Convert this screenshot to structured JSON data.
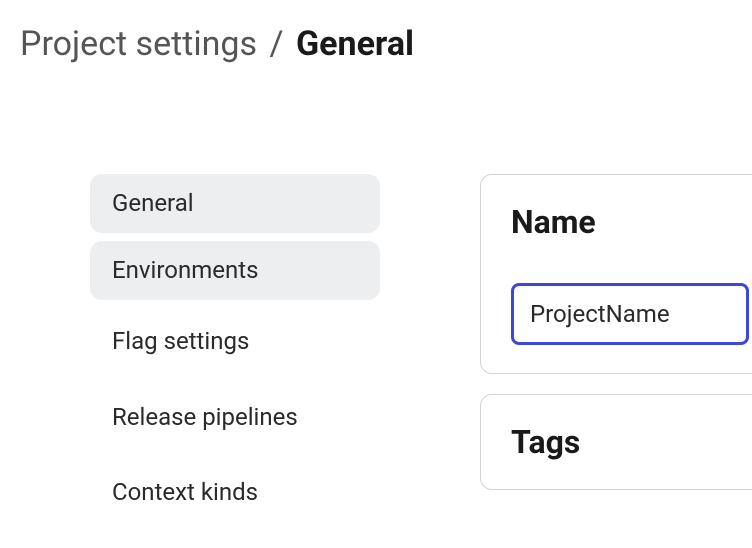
{
  "breadcrumb": {
    "parent": "Project settings",
    "separator": "/",
    "current": "General"
  },
  "sidebar": {
    "items": [
      {
        "label": "General",
        "active": true
      },
      {
        "label": "Environments",
        "active": true
      },
      {
        "label": "Flag settings",
        "active": false
      },
      {
        "label": "Release pipelines",
        "active": false
      },
      {
        "label": "Context kinds",
        "active": false
      }
    ]
  },
  "main": {
    "name_section": {
      "title": "Name",
      "value": "ProjectName"
    },
    "tags_section": {
      "title": "Tags"
    }
  }
}
